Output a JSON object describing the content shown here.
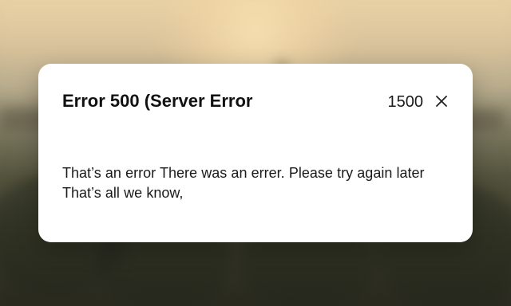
{
  "dialog": {
    "title": "Error 500 (Server Error",
    "code": "1500",
    "message": "That’s an error There was an errer. Please try again later That’s all we know,",
    "close_icon": "close-icon"
  }
}
